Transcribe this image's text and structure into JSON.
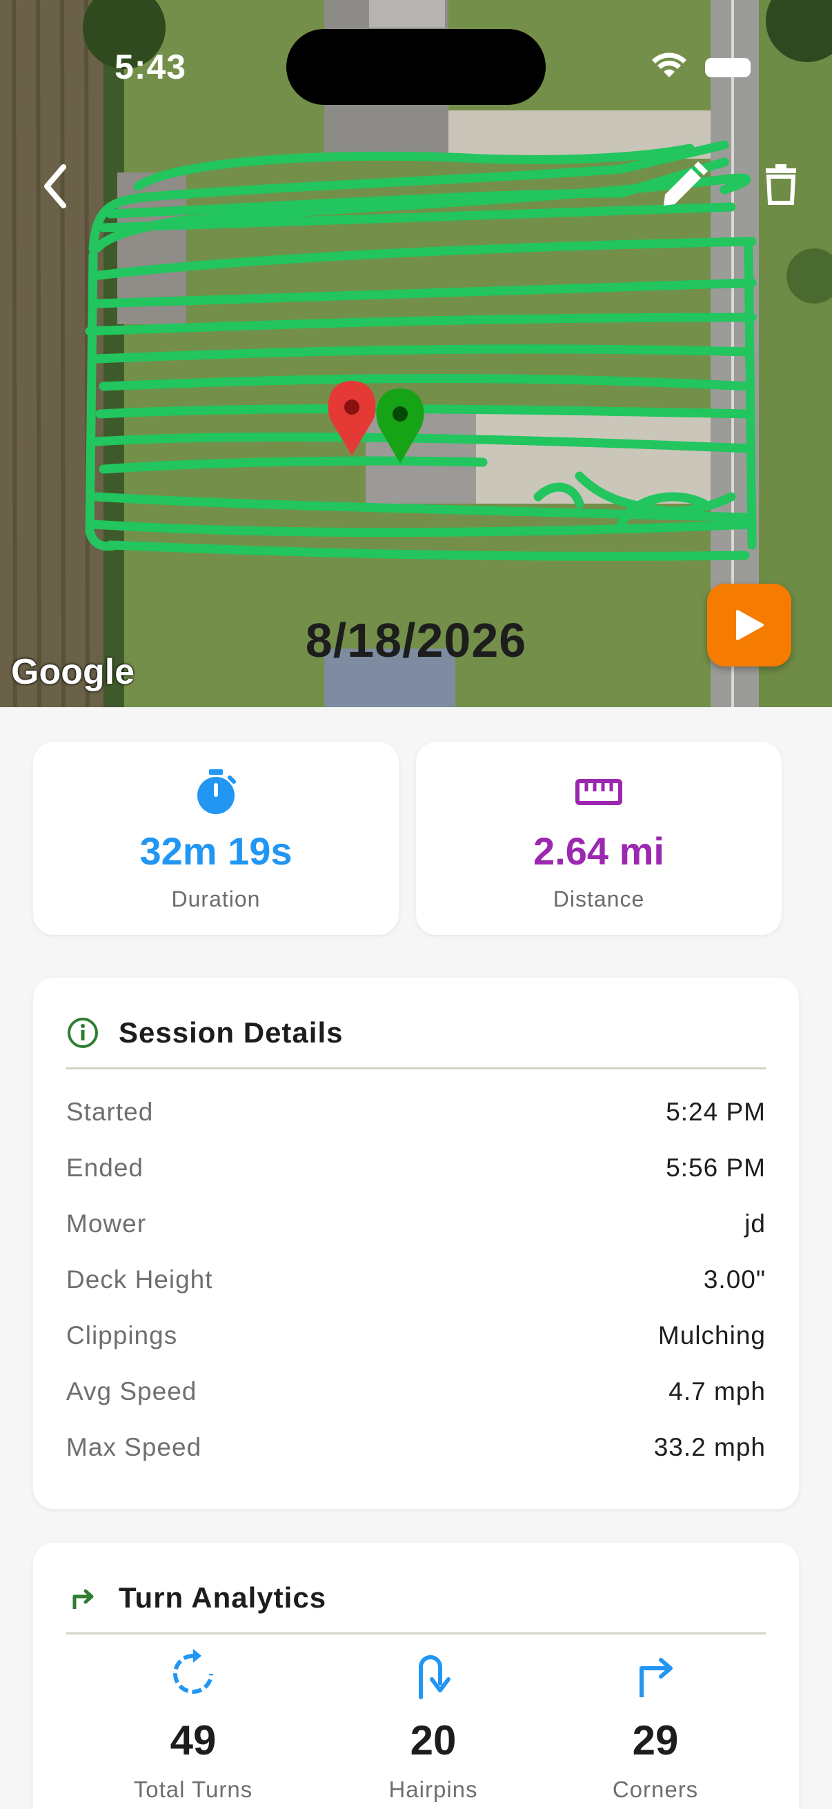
{
  "status_bar": {
    "time": "5:43"
  },
  "map": {
    "date": "8/18/2026",
    "provider_logo": "Google",
    "icons": {
      "back": "chevron-left-icon",
      "edit": "pencil-icon",
      "delete": "trash-icon",
      "play": "play-icon",
      "start_marker": "red-pin-icon",
      "end_marker": "green-pin-icon"
    },
    "track_color": "#22c55e"
  },
  "stats": {
    "duration": {
      "value": "32m 19s",
      "label": "Duration",
      "color": "#2196f3",
      "icon": "stopwatch-icon"
    },
    "distance": {
      "value": "2.64 mi",
      "label": "Distance",
      "color": "#9c27b0",
      "icon": "ruler-icon"
    }
  },
  "session_details": {
    "title": "Session Details",
    "icon": "info-icon",
    "rows": [
      {
        "label": "Started",
        "value": "5:24 PM"
      },
      {
        "label": "Ended",
        "value": "5:56 PM"
      },
      {
        "label": "Mower",
        "value": "jd"
      },
      {
        "label": "Deck Height",
        "value": "3.00\""
      },
      {
        "label": "Clippings",
        "value": "Mulching"
      },
      {
        "label": "Avg Speed",
        "value": "4.7 mph"
      },
      {
        "label": "Max Speed",
        "value": "33.2 mph"
      }
    ]
  },
  "turn_analytics": {
    "title": "Turn Analytics",
    "icon": "turn-right-icon",
    "accent": "#2e7d32",
    "stats": [
      {
        "value": "49",
        "label": "Total Turns",
        "icon": "rotate-icon"
      },
      {
        "value": "20",
        "label": "Hairpins",
        "icon": "u-turn-icon"
      },
      {
        "value": "29",
        "label": "Corners",
        "icon": "corner-turn-icon"
      }
    ]
  }
}
